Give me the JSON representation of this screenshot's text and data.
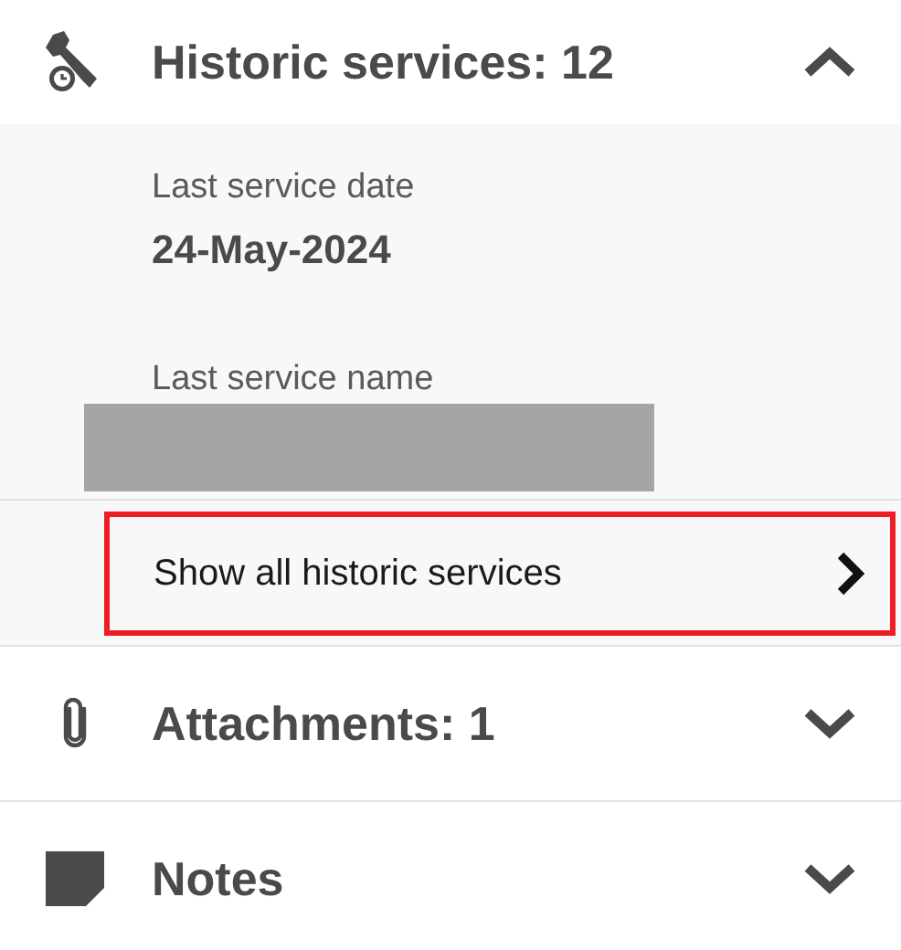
{
  "sections": [
    {
      "kind": "services",
      "title": "Historic services: 12",
      "expanded": true,
      "fields": [
        {
          "label": "Last service date",
          "value": "24-May-2024",
          "redacted": false
        },
        {
          "label": "Last service name",
          "redacted": true
        }
      ],
      "link": {
        "label": "Show all historic services",
        "highlighted": true
      }
    },
    {
      "kind": "attachments",
      "title": "Attachments: 1",
      "expanded": false
    },
    {
      "kind": "notes",
      "title": "Notes",
      "expanded": false
    }
  ]
}
